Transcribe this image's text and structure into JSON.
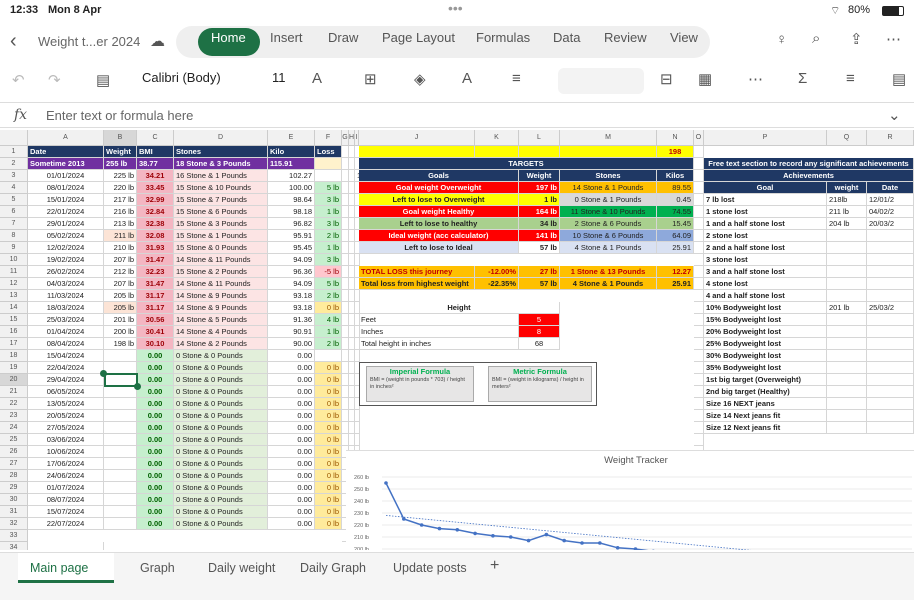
{
  "status": {
    "time": "12:33",
    "date": "Mon 8 Apr",
    "battery": "80%"
  },
  "doc_title": "Weight t...er 2024",
  "tabs": [
    "Home",
    "Insert",
    "Draw",
    "Page Layout",
    "Formulas",
    "Data",
    "Review",
    "View"
  ],
  "font_name": "Calibri (Body)",
  "font_size": "11",
  "formula_placeholder": "Enter text or formula here",
  "fx": "fx",
  "col_headers": [
    "A",
    "B",
    "C",
    "D",
    "E",
    "F",
    "G",
    "H",
    "I",
    "J",
    "K",
    "L",
    "M",
    "N",
    "O",
    "P",
    "Q",
    "R"
  ],
  "main_header": [
    "Date",
    "Weight",
    "BMI",
    "Stones",
    "Kilo",
    "Loss"
  ],
  "main_row2": [
    "Sometime 2013",
    "255 lb",
    "38.77",
    "18 Stone & 3 Pounds",
    "115.91",
    ""
  ],
  "main_rows": [
    [
      "01/01/2024",
      "225 lb",
      "34.21",
      "16 Stone & 1 Pounds",
      "102.27",
      ""
    ],
    [
      "08/01/2024",
      "220 lb",
      "33.45",
      "15 Stone & 10 Pounds",
      "100.00",
      "5 lb"
    ],
    [
      "15/01/2024",
      "217 lb",
      "32.99",
      "15 Stone & 7 Pounds",
      "98.64",
      "3 lb"
    ],
    [
      "22/01/2024",
      "216 lb",
      "32.84",
      "15 Stone & 6 Pounds",
      "98.18",
      "1 lb"
    ],
    [
      "29/01/2024",
      "213 lb",
      "32.38",
      "15 Stone & 3 Pounds",
      "96.82",
      "3 lb"
    ],
    [
      "05/02/2024",
      "211 lb",
      "32.08",
      "15 Stone & 1 Pounds",
      "95.91",
      "2 lb"
    ],
    [
      "12/02/2024",
      "210 lb",
      "31.93",
      "15 Stone & 0 Pounds",
      "95.45",
      "1 lb"
    ],
    [
      "19/02/2024",
      "207 lb",
      "31.47",
      "14 Stone & 11 Pounds",
      "94.09",
      "3 lb"
    ],
    [
      "26/02/2024",
      "212 lb",
      "32.23",
      "15 Stone & 2 Pounds",
      "96.36",
      "-5 lb"
    ],
    [
      "04/03/2024",
      "207 lb",
      "31.47",
      "14 Stone & 11 Pounds",
      "94.09",
      "5 lb"
    ],
    [
      "11/03/2024",
      "205 lb",
      "31.17",
      "14 Stone & 9 Pounds",
      "93.18",
      "2 lb"
    ],
    [
      "18/03/2024",
      "205 lb",
      "31.17",
      "14 Stone & 9 Pounds",
      "93.18",
      "0 lb"
    ],
    [
      "25/03/2024",
      "201 lb",
      "30.56",
      "14 Stone & 5 Pounds",
      "91.36",
      "4 lb"
    ],
    [
      "01/04/2024",
      "200 lb",
      "30.41",
      "14 Stone & 4 Pounds",
      "90.91",
      "1 lb"
    ],
    [
      "08/04/2024",
      "198 lb",
      "30.10",
      "14 Stone & 2 Pounds",
      "90.00",
      "2 lb"
    ],
    [
      "15/04/2024",
      "",
      "0.00",
      "0 Stone & 0 Pounds",
      "0.00",
      ""
    ],
    [
      "22/04/2024",
      "",
      "0.00",
      "0 Stone & 0 Pounds",
      "0.00",
      "0 lb"
    ],
    [
      "29/04/2024",
      "",
      "0.00",
      "0 Stone & 0 Pounds",
      "0.00",
      "0 lb"
    ],
    [
      "06/05/2024",
      "",
      "0.00",
      "0 Stone & 0 Pounds",
      "0.00",
      "0 lb"
    ],
    [
      "13/05/2024",
      "",
      "0.00",
      "0 Stone & 0 Pounds",
      "0.00",
      "0 lb"
    ],
    [
      "20/05/2024",
      "",
      "0.00",
      "0 Stone & 0 Pounds",
      "0.00",
      "0 lb"
    ],
    [
      "27/05/2024",
      "",
      "0.00",
      "0 Stone & 0 Pounds",
      "0.00",
      "0 lb"
    ],
    [
      "03/06/2024",
      "",
      "0.00",
      "0 Stone & 0 Pounds",
      "0.00",
      "0 lb"
    ],
    [
      "10/06/2024",
      "",
      "0.00",
      "0 Stone & 0 Pounds",
      "0.00",
      "0 lb"
    ],
    [
      "17/06/2024",
      "",
      "0.00",
      "0 Stone & 0 Pounds",
      "0.00",
      "0 lb"
    ],
    [
      "24/06/2024",
      "",
      "0.00",
      "0 Stone & 0 Pounds",
      "0.00",
      "0 lb"
    ],
    [
      "01/07/2024",
      "",
      "0.00",
      "0 Stone & 0 Pounds",
      "0.00",
      "0 lb"
    ],
    [
      "08/07/2024",
      "",
      "0.00",
      "0 Stone & 0 Pounds",
      "0.00",
      "0 lb"
    ],
    [
      "15/07/2024",
      "",
      "0.00",
      "0 Stone & 0 Pounds",
      "0.00",
      "0 lb"
    ],
    [
      "22/07/2024",
      "",
      "0.00",
      "0 Stone & 0 Pounds",
      "0.00",
      "0 lb"
    ]
  ],
  "n1": "198",
  "i3": "1",
  "targets_title": "TARGETS",
  "targets_header": [
    "Goals",
    "Weight",
    "Stones",
    "Kilos"
  ],
  "targets": [
    [
      "Goal weight Overweight",
      "197 lb",
      "14 Stone & 1 Pounds",
      "89.55"
    ],
    [
      "Left to lose to Overweight",
      "1 lb",
      "0 Stone & 1 Pounds",
      "0.45"
    ],
    [
      "Goal weight Healthy",
      "164 lb",
      "11 Stone & 10 Pounds",
      "74.55"
    ],
    [
      "Left to lose to healthy",
      "34 lb",
      "2 Stone & 6 Pounds",
      "15.45"
    ],
    [
      "Ideal weight (acc calculator)",
      "141 lb",
      "10 Stone & 6 Pounds",
      "64.09"
    ],
    [
      "Left to lose to Ideal",
      "57 lb",
      "4 Stone & 1 Pounds",
      "25.91"
    ]
  ],
  "total_loss": [
    "TOTAL LOSS this journey",
    "-12.00%",
    "27 lb",
    "1 Stone & 13 Pounds",
    "12.27"
  ],
  "total_high": [
    "Total loss from highest weight",
    "-22.35%",
    "57 lb",
    "4 Stone & 1 Pounds",
    "25.91"
  ],
  "height": {
    "title": "Height",
    "feet_label": "Feet",
    "feet": "5",
    "inches_label": "Inches",
    "inches": "8",
    "total_label": "Total height in inches",
    "total": "68"
  },
  "formulas": {
    "imperial_title": "Imperial Formula",
    "imperial_text": "BMI = (weight in pounds * 703) / height in inches²",
    "metric_title": "Metric Formula",
    "metric_text": "BMI = (weight in kilograms) / height in meters²"
  },
  "ach_title1": "Free text section to record any significant achievements",
  "ach_title2": "Achievements",
  "ach_header": [
    "Goal",
    "weight",
    "Date"
  ],
  "achievements": [
    [
      "7 lb lost",
      "218lb",
      "12/01/2"
    ],
    [
      "1 stone lost",
      "211 lb",
      "04/02/2"
    ],
    [
      "1 and a half stone lost",
      "204 lb",
      "20/03/2"
    ],
    [
      "2 stone lost",
      "",
      ""
    ],
    [
      "2 and a half stone lost",
      "",
      ""
    ],
    [
      "3 stone lost",
      "",
      ""
    ],
    [
      "3 and a half stone lost",
      "",
      ""
    ],
    [
      "4 stone lost",
      "",
      ""
    ],
    [
      "4 and a half stone lost",
      "",
      ""
    ],
    [
      "10% Bodyweight lost",
      "201 lb",
      "25/03/2"
    ],
    [
      "15% Bodyweight lost",
      "",
      ""
    ],
    [
      "20% Bodyweight lost",
      "",
      ""
    ],
    [
      "25% Bodyweight lost",
      "",
      ""
    ],
    [
      "30% Bodyweight lost",
      "",
      ""
    ],
    [
      "35% Bodyweight lost",
      "",
      ""
    ],
    [
      "1st big target (Overweight)",
      "",
      ""
    ],
    [
      "2nd big target (Healthy)",
      "",
      ""
    ],
    [
      "Size 16 NEXT jeans",
      "",
      ""
    ],
    [
      "Size 14 Next jeans fit",
      "",
      ""
    ],
    [
      "Size 12 Next jeans fit",
      "",
      ""
    ]
  ],
  "chart_data": {
    "type": "line",
    "title": "Weight Tracker",
    "ylabels": [
      "260 lb",
      "250 lb",
      "240 lb",
      "230 lb",
      "220 lb",
      "210 lb",
      "200 lb",
      "190 lb"
    ],
    "ylim": [
      190,
      260
    ],
    "series": [
      {
        "values": [
          255,
          225,
          220,
          217,
          216,
          213,
          211,
          210,
          207,
          212,
          207,
          205,
          205,
          201,
          200,
          198
        ],
        "color": "#4472c4"
      },
      {
        "values": [
          197,
          197,
          197,
          197,
          197,
          197,
          197,
          197,
          197,
          197,
          197,
          197,
          197,
          197,
          197,
          197,
          197,
          197,
          197,
          197,
          197,
          197,
          197,
          197,
          197,
          197,
          197,
          197,
          197,
          197
        ],
        "color": "#ed7d31"
      }
    ]
  },
  "sheet_tabs": [
    "Main page",
    "Graph",
    "Daily weight",
    "Daily Graph",
    "Update posts"
  ],
  "add_sheet": "+"
}
